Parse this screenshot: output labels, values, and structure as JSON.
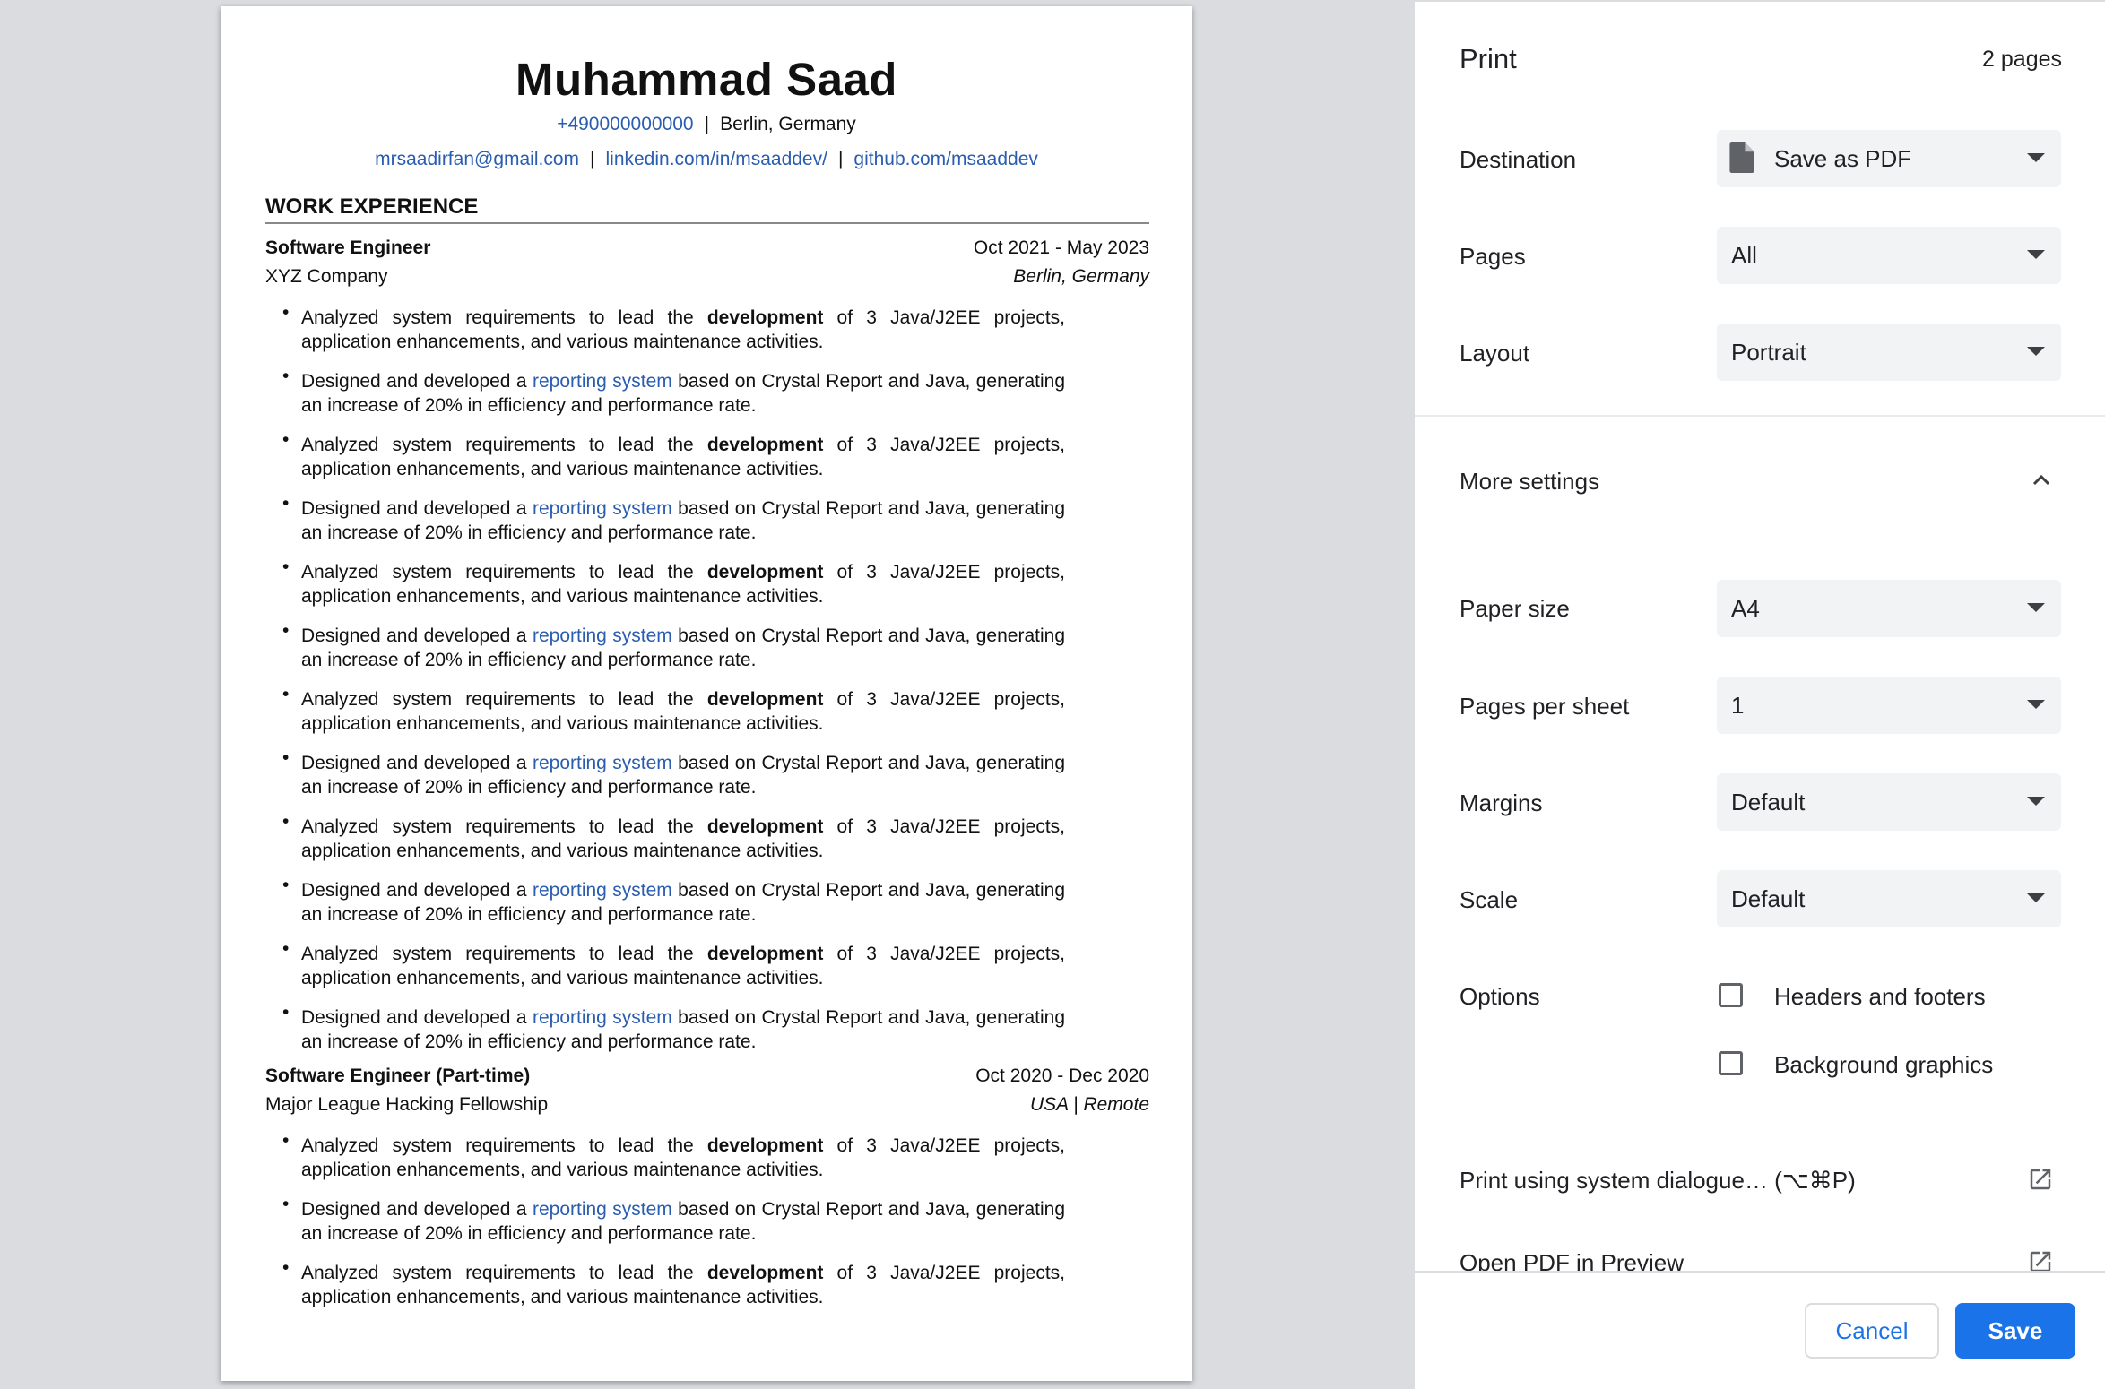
{
  "resume": {
    "name": "Muhammad Saad",
    "phone": "+490000000000",
    "location": "Berlin, Germany",
    "email": "mrsaadirfan@gmail.com",
    "linkedin": "linkedin.com/in/msaaddev/",
    "github": "github.com/msaaddev",
    "separator": "|",
    "section_title": "WORK EXPERIENCE",
    "bullet_a": {
      "pre": "Analyzed system requirements to lead the ",
      "bold": "development",
      "post": " of 3 Java/J2EE projects, application enhancements, and various maintenance activities."
    },
    "bullet_b": {
      "pre": "Designed and developed a ",
      "link": "reporting system",
      "post": " based on Crystal Report and Java, generating an increase of 20% in efficiency and performance rate."
    },
    "jobs": [
      {
        "title": "Software Engineer",
        "dates": "Oct 2021 - May 2023",
        "company": "XYZ Company",
        "location": "Berlin, Germany"
      },
      {
        "title": "Software Engineer (Part-time)",
        "dates": "Oct 2020 - Dec 2020",
        "company": "Major League Hacking Fellowship",
        "location": "USA | Remote"
      }
    ]
  },
  "print": {
    "title": "Print",
    "page_count": "2 pages",
    "destination_label": "Destination",
    "destination_value": "Save as PDF",
    "pages_label": "Pages",
    "pages_value": "All",
    "layout_label": "Layout",
    "layout_value": "Portrait",
    "more_settings": "More settings",
    "paper_size_label": "Paper size",
    "paper_size_value": "A4",
    "pages_per_sheet_label": "Pages per sheet",
    "pages_per_sheet_value": "1",
    "margins_label": "Margins",
    "margins_value": "Default",
    "scale_label": "Scale",
    "scale_value": "Default",
    "options_label": "Options",
    "headers_footers": "Headers and footers",
    "background_graphics": "Background graphics",
    "system_dialogue": "Print using system dialogue… (⌥⌘P)",
    "open_pdf": "Open PDF in Preview",
    "cancel": "Cancel",
    "save": "Save",
    "accent_color": "#1a73e8"
  }
}
